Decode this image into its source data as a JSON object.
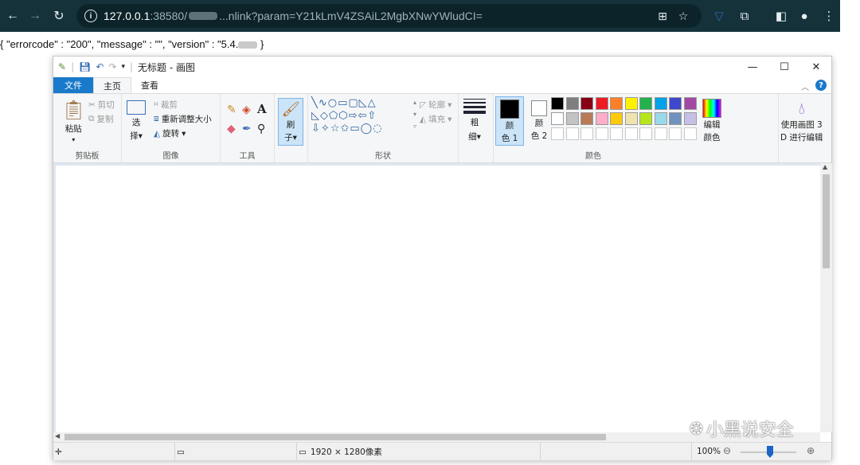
{
  "browser": {
    "url_host": "127.0.0.1",
    "url_port": ":38580/",
    "url_path": "...nlink?param=Y21kLmV4ZSAiL2MgbXNwYWludCI="
  },
  "page_text": {
    "part1": "{ \"errorcode\" : \"200\", \"message\" : \"\", \"version\" : \"5.4.",
    "part2": " }"
  },
  "paint": {
    "title": "无标题 - 画图",
    "tabs": [
      "文件",
      "主页",
      "查看"
    ],
    "groups": {
      "clipboard": {
        "label": "剪贴板",
        "paste": "粘贴",
        "cut": "剪切",
        "copy": "复制"
      },
      "image": {
        "label": "图像",
        "select_a": "选",
        "select_b": "择",
        "crop": "裁剪",
        "resize": "重新调整大小",
        "rotate": "旋转"
      },
      "tools": {
        "label": "工具"
      },
      "brush": {
        "a": "刷",
        "b": "子"
      },
      "shapes": {
        "label": "形状",
        "outline": "轮廓",
        "fill": "填充"
      },
      "size": {
        "a": "粗",
        "b": "细"
      },
      "colors": {
        "label": "颜色",
        "color1_a": "颜",
        "color1_b": "色 1",
        "color2_a": "颜",
        "color2_b": "色 2",
        "edit_a": "编辑",
        "edit_b": "颜色",
        "paint3d_a": "使用画图 3",
        "paint3d_b": "D 进行编辑",
        "row1": [
          "#000000",
          "#7f7f7f",
          "#880015",
          "#ed1c24",
          "#ff7f27",
          "#fff200",
          "#22b14c",
          "#00a2e8",
          "#3f48cc",
          "#a349a4"
        ],
        "row2": [
          "#ffffff",
          "#c3c3c3",
          "#b97a57",
          "#ffaec9",
          "#ffc90e",
          "#efe4b0",
          "#b5e61d",
          "#99d9ea",
          "#7092be",
          "#c8bfe7"
        ]
      }
    },
    "status": {
      "dimensions": "1920 × 1280像素",
      "zoom": "100%"
    }
  },
  "watermark": "小黑说安全"
}
